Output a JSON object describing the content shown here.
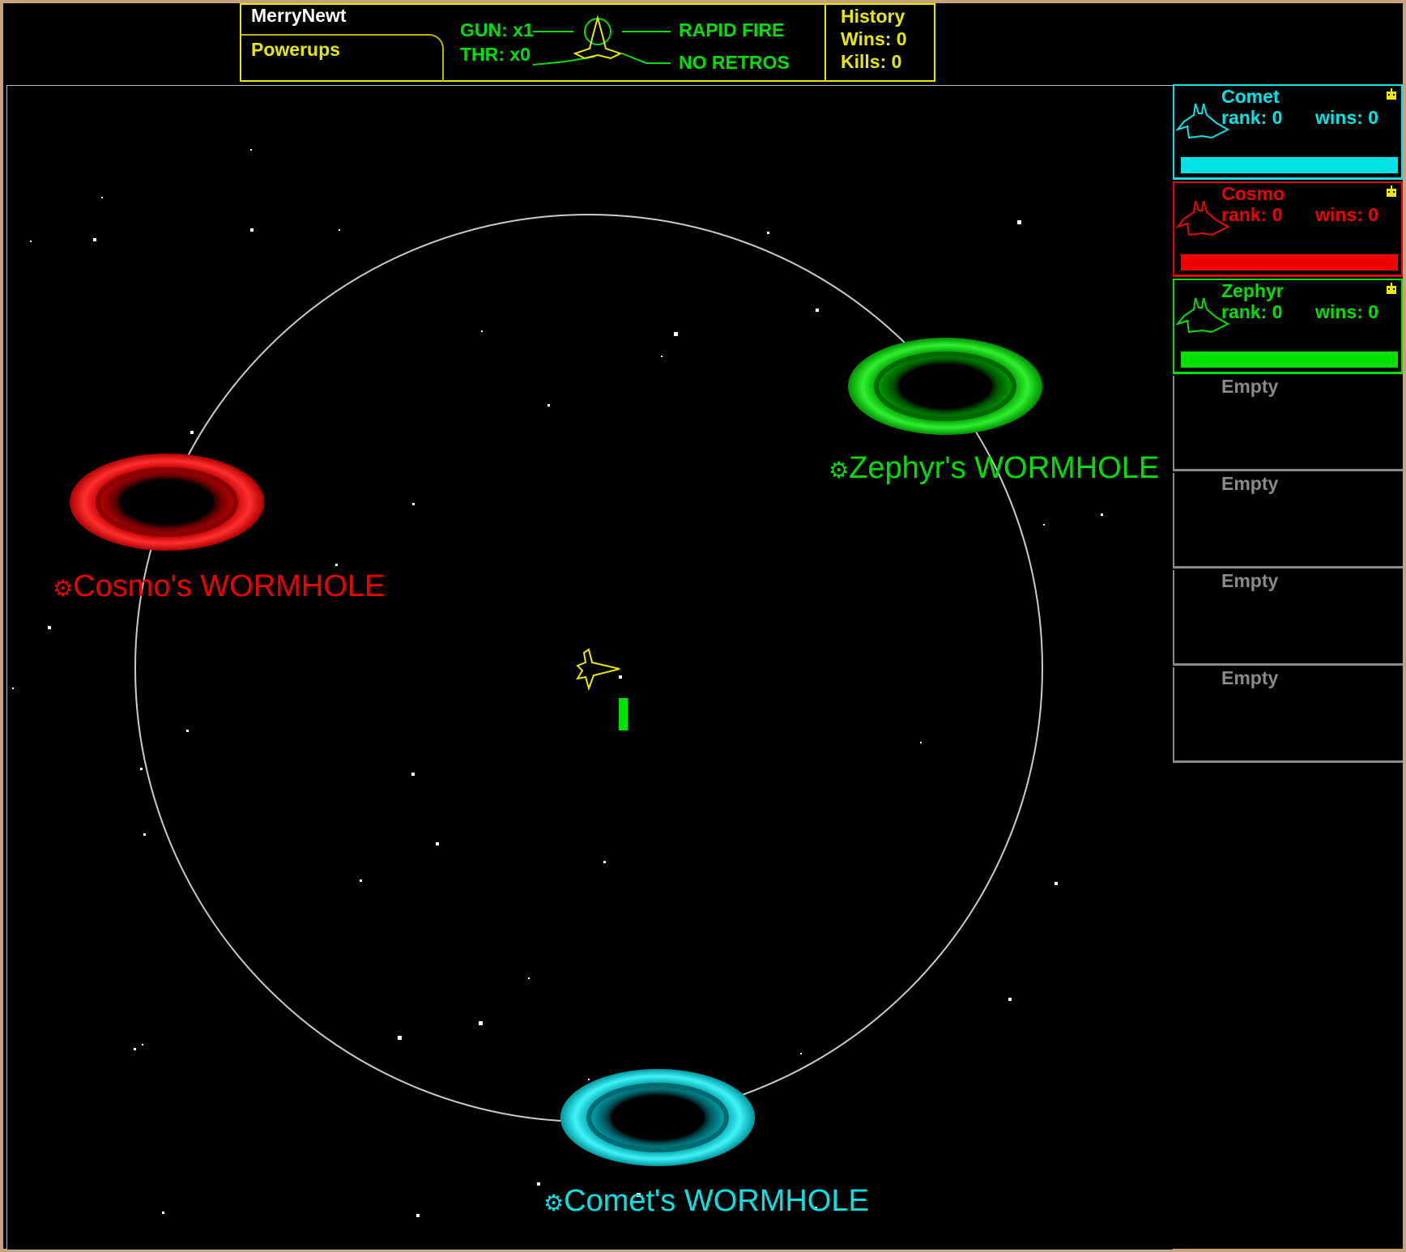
{
  "hud": {
    "player_name": "MerryNewt",
    "powerups_label": "Powerups",
    "gun": "GUN: x1",
    "thrust": "THR: x0",
    "rapid_fire": "RAPID FIRE",
    "retros": "NO RETROS",
    "history_label": "History",
    "wins": "Wins: 0",
    "kills": "Kills: 0"
  },
  "wormholes": [
    {
      "label": "Cosmo's WORMHOLE",
      "color": "#ee0000"
    },
    {
      "label": "Zephyr's WORMHOLE",
      "color": "#00e000"
    },
    {
      "label": "Comet's WORMHOLE",
      "color": "#00e4e8"
    }
  ],
  "players": [
    {
      "name": "Comet",
      "rank": "rank: 0",
      "wins": "wins: 0",
      "color": "#00e4e8",
      "icon": "robot-icon"
    },
    {
      "name": "Cosmo",
      "rank": "rank: 0",
      "wins": "wins: 0",
      "color": "#ee0000",
      "icon": "robot-icon"
    },
    {
      "name": "Zephyr",
      "rank": "rank: 0",
      "wins": "wins: 0",
      "color": "#00e000",
      "icon": "robot-icon"
    }
  ],
  "empty_slots": [
    "Empty",
    "Empty",
    "Empty",
    "Empty"
  ],
  "colors": {
    "hud": "#e8e800",
    "ship": "#e8e800",
    "arena_ring": "#cccccc",
    "background": "#000000",
    "frame": "#c8a27a"
  }
}
